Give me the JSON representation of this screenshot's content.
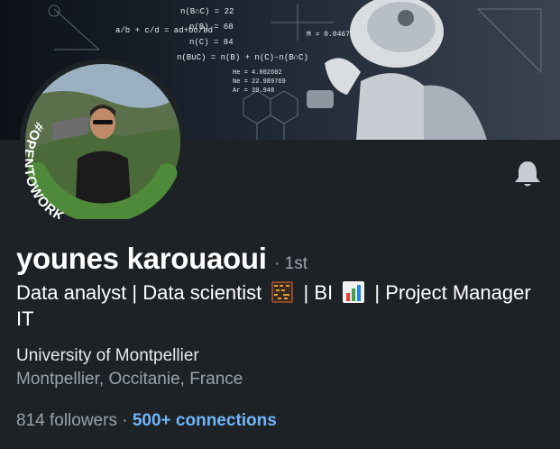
{
  "profile": {
    "name": "younes karouaoui",
    "degree": "· 1st",
    "headline_parts": {
      "part1": "Data analyst | Data scientist",
      "part2": "| BI",
      "part3": "| Project Manager IT"
    },
    "school": "University of Montpellier",
    "location": "Montpellier, Occitanie, France",
    "followers": "814 followers",
    "separator": "·",
    "connections": "500+ connections",
    "open_to_work": "#OPENTOWORK"
  },
  "banner": {
    "formulas": {
      "f1": "n(B∩C) = 22",
      "f2": "n(B) = 68",
      "f3": "n(C) = 84",
      "f4": "n(B∪C) = n(B) + n(C)-n(B∩C)",
      "f5": "a/b + c/d = ad+bc/bd",
      "f6": "M = 0.0467",
      "f7": "He = 4.002602",
      "f8": "Ne = 22.989769",
      "f9": "Ar = 39.948"
    }
  },
  "icons": {
    "bell": "bell-icon",
    "abacus": "abacus-icon",
    "bar_chart": "bar-chart-icon"
  },
  "colors": {
    "background": "#1d2226",
    "link": "#70b5f9",
    "open_to_work_green": "#4f8a3a"
  }
}
